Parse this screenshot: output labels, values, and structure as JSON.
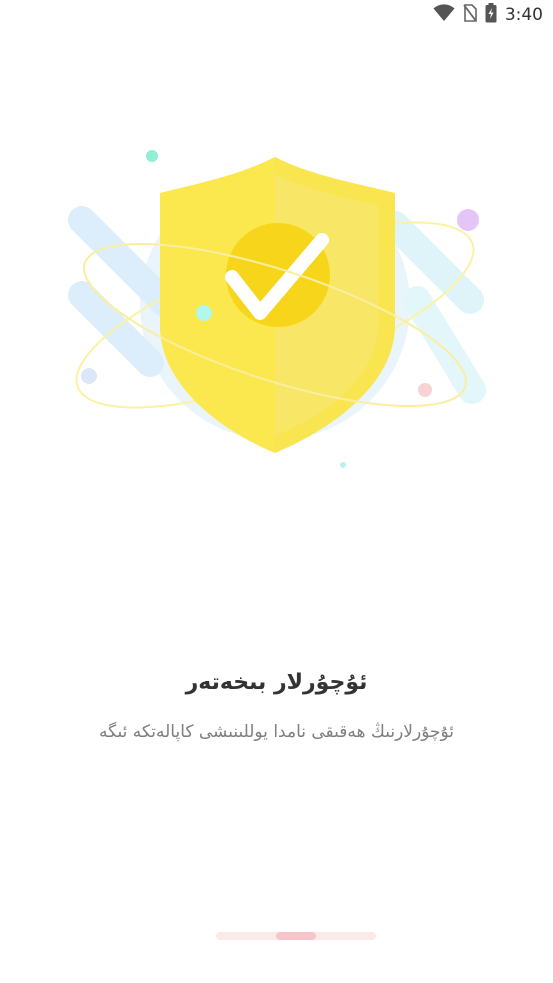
{
  "status_bar": {
    "time": "3:40",
    "icons": [
      "wifi-icon",
      "no-sim-icon",
      "battery-charging-icon"
    ]
  },
  "onboarding": {
    "illustration": "shield-check-icon",
    "title": "ئۇچۇرلار بىخەتەر",
    "description": "ئۇچۇرلارنىڭ ھەقىقى نامدا يوللىنىشى كاپالەتكە ئىگە"
  },
  "pager": {
    "page_count": 3,
    "current_page": 2,
    "active_color": "#f6c6cc",
    "inactive_color": "#fbeaea"
  }
}
